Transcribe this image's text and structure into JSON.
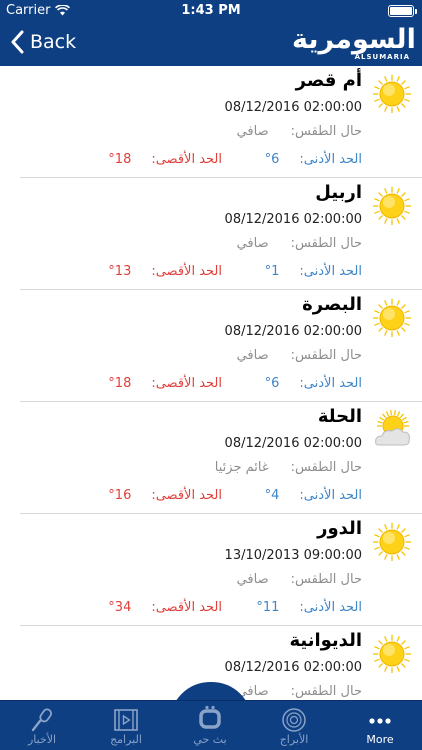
{
  "status_bar": {
    "carrier": "Carrier",
    "time": "1:43 PM"
  },
  "nav": {
    "back_label": "Back",
    "logo_arabic": "السومرية",
    "logo_latin": "ALSUMARIA"
  },
  "labels": {
    "condition": "حال الطقس:",
    "min": "الحد الأدنى:",
    "max": "الحد الأقصى:"
  },
  "weather": [
    {
      "city": "أم قصر",
      "date": "08/12/2016 02:00:00",
      "condition": "صافي",
      "min": "6°",
      "max": "18°",
      "icon": "sun-icon"
    },
    {
      "city": "اربيل",
      "date": "08/12/2016 02:00:00",
      "condition": "صافي",
      "min": "1°",
      "max": "13°",
      "icon": "sun-icon"
    },
    {
      "city": "البصرة",
      "date": "08/12/2016 02:00:00",
      "condition": "صافي",
      "min": "6°",
      "max": "18°",
      "icon": "sun-icon"
    },
    {
      "city": "الحلة",
      "date": "08/12/2016 02:00:00",
      "condition": "غائم جزئيا",
      "min": "4°",
      "max": "16°",
      "icon": "partly-cloudy-icon"
    },
    {
      "city": "الدور",
      "date": "13/10/2013 09:00:00",
      "condition": "صافي",
      "min": "11°",
      "max": "34°",
      "icon": "sun-icon"
    },
    {
      "city": "الديوانية",
      "date": "08/12/2016 02:00:00",
      "condition": "صافي",
      "min": "",
      "max": "",
      "icon": "sun-icon"
    }
  ],
  "tabs": [
    {
      "label": "الأخبار",
      "icon": "microphone-icon",
      "active": false
    },
    {
      "label": "البرامج",
      "icon": "film-icon",
      "active": false
    },
    {
      "label": "بث حي",
      "icon": "live-icon",
      "active": false
    },
    {
      "label": "الأبراج",
      "icon": "zodiac-icon",
      "active": false
    },
    {
      "label": "More",
      "icon": "more-icon",
      "active": true
    }
  ],
  "colors": {
    "bar": "#0e3f82",
    "min_temp": "#3f86c7",
    "max_temp": "#e0413b",
    "muted": "#8e8e8e"
  }
}
